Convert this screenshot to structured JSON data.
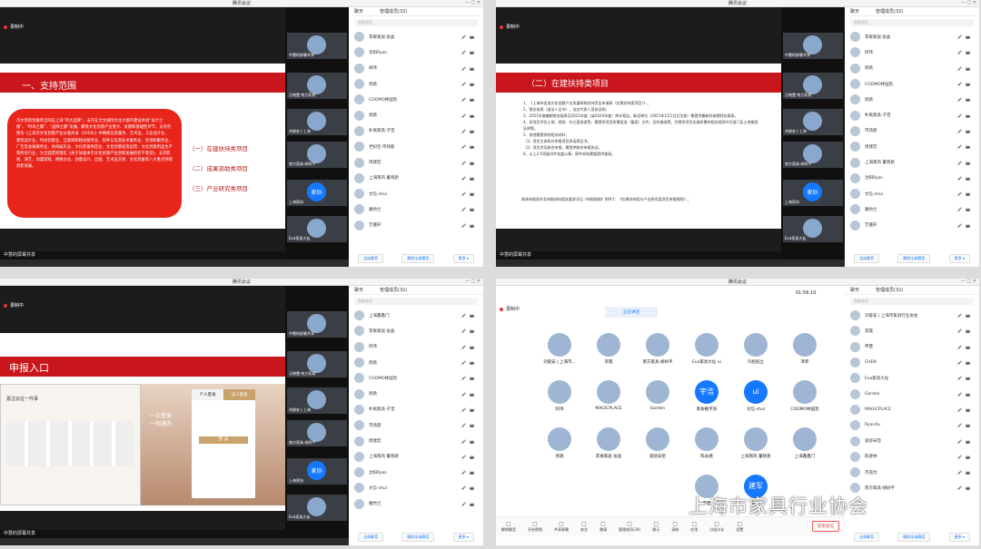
{
  "app_title": "腾讯会议",
  "winctl": "— □ ✕",
  "rec_label": "录制中",
  "share_label": "中慧的屏幕共享",
  "tabs": {
    "chat": "聊天",
    "members": "管理成员(32)"
  },
  "tabs_count": [
    "32",
    "33",
    "34",
    "34"
  ],
  "search_placeholder": "搜索成员",
  "footer": {
    "mute_all": "全体静音",
    "unmute_all": "解除全体静音",
    "more": "更多 ▾"
  },
  "video_names": [
    "中慧的屏幕共享",
    "汪晓雯·南方家具",
    "刘俊安 | 上海",
    "南方家具·胡树平",
    "上海家协",
    "上海家协",
    "Eva家具大仙"
  ],
  "members": [
    [
      "苹果家居 张晶",
      "沈阳Ryan",
      "闻玮",
      "周艳",
      "COOMO林国凯",
      "周艳",
      "朴爽家具-子音",
      "世纪佳·市场部",
      "周建宏",
      "上海南风 董晓艳",
      "文信-shui",
      "雅怡兰",
      "艺雅轩"
    ],
    [
      "苹果家居 张晶",
      "阿玮",
      "周艳",
      "COOMO林国凯",
      "周艳",
      "朴爽家具-子音",
      "市场部",
      "周建宏",
      "上海南风 董晓艳",
      "沈阳Ryan",
      "文信-shui",
      "雅怡兰",
      "艺雅轩"
    ],
    [
      "上海鑫鑫门",
      "苹果家居 张晶",
      "阿玮",
      "周艳",
      "COOMO林国凯",
      "周艳",
      "朴爽家具-子音",
      "市场部",
      "周建宏",
      "上海南风 董晓艳",
      "沈阳Ryan",
      "文信-shui",
      "雅怡兰"
    ],
    [
      "刘俊安 | 上海市家具行业协会",
      "李霞",
      "申慧",
      "CHEN",
      "Eva家具大仙",
      "Gordon",
      "MAGICPLACE",
      "RyanXu",
      "爱舒床垫",
      "陈建林",
      "杰克烁",
      "南方家具·胡树平"
    ]
  ],
  "slide1": {
    "title": "一、支持范围",
    "body": "市文创资金服务自响应上海“四大品牌”，支持在全文国际文化大都市建设并具“设计之都”、“时尚之都”、“品牌之都”发展。聚焦文化创意产业重大、关键和基础性环节，支持范围为《上海市文化创意产业分类目录（2018）》中网络信息服务、艺术业、工业设计业、建筑设计业、时尚创意业、互联网和相关服务业、软件与信息技术服务业、咨询和服务业、广告及会展服务业、休闲娱乐业、文化装备制造业、文化创意投资运营、文化创意用品生产等所有行业，为全面贯彻落实《关于加强本市文化创意产业创新发展的若干意见》，支持影视、演艺、动漫游戏、网络文化、创意设计、出版、艺术品交易、文化装备等八大重点领域创新发展。",
    "items": [
      "（一）在建扶持类项目",
      "（二）成果资助类项目",
      "（三）产业研究类项目"
    ]
  },
  "slide2": {
    "title": "（二）在建扶持类项目",
    "lines": [
      "1、《上海市促进文化创意产业发展财政扶持资金申请表（在建扶持类项目）》。",
      "2、营业执照（或法人证书），法定代表人身份证明。",
      "3、2021年度编制财务报表及2021年度（或2020年度）审计报告。新设单位（2021年1月1日后注册）需提供最新的纳税财务报表。",
      "4、如项目涉及土地、规划、外立面改造等，需提供项目所需批准（备案）文件，及时查阅等，并提供项目实施所需的相关规划许可部门及土地使用证明等。",
      "5、其他需提供的相关材料：",
      "（1）项目主体所对申报项目承诺保证书。",
      "（2）项目涉及联合申报，需提供联合申报协议。",
      "6、以上2-5项复印件加盖公章，原件如有需要提供查阅。"
    ],
    "footer": "具体申报条件及申报材料相关要求详见《申报指南》附件1：《在建扶持类与产业研究类项目申报细则》。"
  },
  "slide3": {
    "title": "申报入口",
    "web_title": "嘉注云在一件事",
    "login_tabs": [
      "个人登录",
      "法人登录"
    ],
    "login_btn": "登 录",
    "slogan": "一次登录\n一网通办"
  },
  "grid": {
    "people": [
      "刘俊安 | 上海市...",
      "李霞",
      "南方家具·胡树平",
      "Eva家具大仙 ui",
      "玛招低立",
      "菲菲",
      "阿玮",
      "MAGICPLACE",
      "Gordon",
      "家协推宇浩",
      "文信-shui",
      "COOMO林国凯",
      "周艳",
      "苹果家居 张晶",
      "爱舒床垫",
      "陈永绪",
      "上海南风 董晓艳",
      "上海鑫鑫门",
      "申慧",
      "建军"
    ],
    "bubbles": [
      "宇浩",
      "ui",
      "建军"
    ],
    "speaking": "正在讲话",
    "timer": "01:56:10",
    "bar": [
      "解除静音",
      "开启视频",
      "共享屏幕",
      "安全",
      "邀请",
      "管理成员(34)",
      "聊天",
      "录制",
      "应用",
      "分组讨论",
      "设置"
    ],
    "leave": "结束会议",
    "status": "正在讲话: 申慧"
  },
  "watermark": "上海市家具行业协会"
}
